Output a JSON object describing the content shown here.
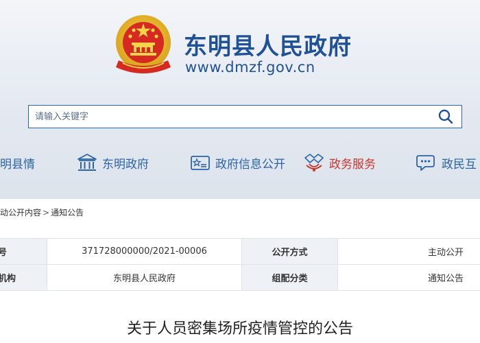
{
  "site": {
    "title": "东明县人民政府",
    "url": "www.dmzf.gov.cn"
  },
  "search": {
    "placeholder": "请输入关键字"
  },
  "nav": {
    "items": [
      {
        "label": "明县情",
        "icon": "info-icon"
      },
      {
        "label": "东明政府",
        "icon": "government-building-icon"
      },
      {
        "label": "政府信息公开",
        "icon": "info-disclosure-icon"
      },
      {
        "label": "政务服务",
        "icon": "handshake-icon"
      },
      {
        "label": "政民互",
        "icon": "chat-bubble-icon"
      }
    ]
  },
  "breadcrumb": {
    "items": [
      "动公开内容",
      "通知公告"
    ],
    "separator": ">"
  },
  "info": {
    "row1": {
      "label1": "号",
      "value1": "371728000000/2021-00006",
      "label2": "公开方式",
      "value2": "主动公开"
    },
    "row2": {
      "label1": "机构",
      "value1": "东明县人民政府",
      "label2": "组配分类",
      "value2": "通知公告"
    }
  },
  "document": {
    "title": "关于人员密集场所疫情管控的公告"
  },
  "colors": {
    "brand_blue": "#1f5196",
    "nav_blue": "#2a63a8",
    "accent_red": "#c8362f",
    "emblem_gold": "#f2c230"
  }
}
